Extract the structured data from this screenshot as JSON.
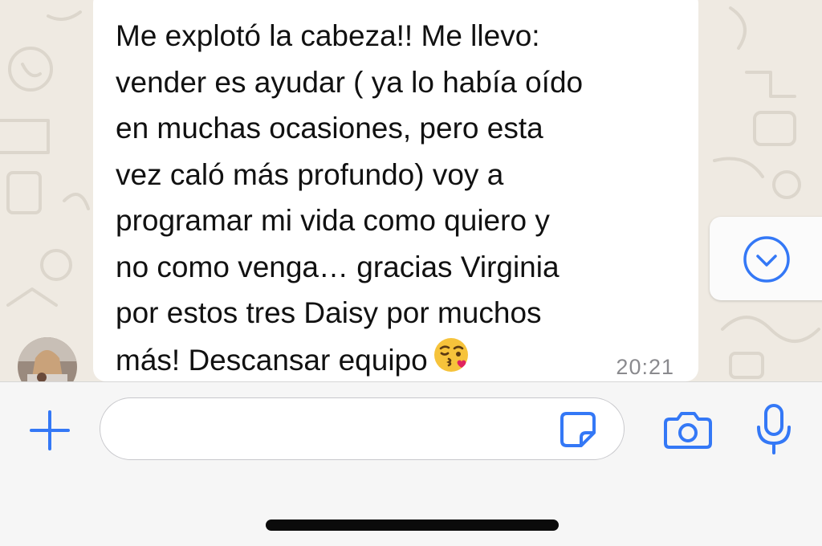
{
  "message": {
    "text": "Me explotó la cabeza!!  Me llevo:\nvender es ayudar ( ya lo había oído\nen muchas ocasiones, pero esta\nvez caló más profundo) voy a\nprogramar mi vida como quiero y\nno como venga… gracias Virginia\npor estos tres Daisy por muchos\nmás! Descansar equipo",
    "emoji": "face-blowing-a-kiss",
    "time": "20:21"
  },
  "composer": {
    "placeholder": ""
  },
  "icons": {
    "attach": "plus-icon",
    "sticker": "sticker-icon",
    "camera": "camera-icon",
    "voice": "microphone-icon",
    "scroll": "chevron-down-circle-icon"
  },
  "colors": {
    "accent": "#3478f6",
    "chat_background": "#efeae2",
    "bubble": "#ffffff",
    "timestamp": "#8a8a8e"
  }
}
